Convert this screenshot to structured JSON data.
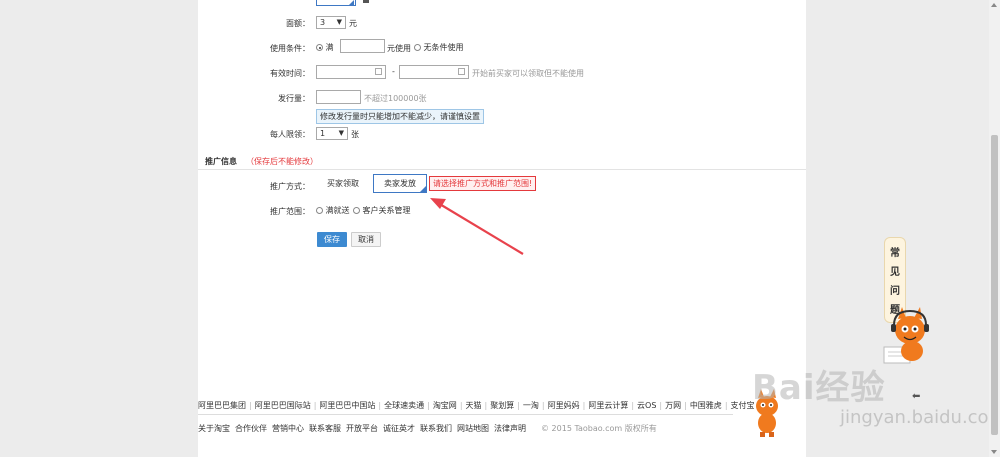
{
  "form": {
    "top_partial_label": "",
    "face_value": {
      "label": "面额：",
      "value": "3",
      "unit": "元"
    },
    "usage_condition": {
      "label": "使用条件：",
      "option_full": "满",
      "full_unit": "元使用",
      "option_none": "无条件使用"
    },
    "valid_time": {
      "label": "有效时间：",
      "dash": "-",
      "hint": "开始前买家可以领取但不能使用"
    },
    "circulation": {
      "label": "发行量：",
      "placeholder": "不超过100000张",
      "tip": "修改发行量时只能增加不能减少，请谨慎设置"
    },
    "limit_per_person": {
      "label": "每人限领：",
      "value": "1",
      "unit": "张"
    }
  },
  "promotion": {
    "section_title": "推广信息",
    "section_note": "（保存后不能修改）",
    "method_label": "推广方式：",
    "method_buyer": "买家领取",
    "method_seller": "卖家发放",
    "error_text": "请选择推广方式和推广范围!",
    "scope_label": "推广范围：",
    "scope_option1": "满就送",
    "scope_option2": "客户关系管理"
  },
  "actions": {
    "save": "保存",
    "cancel": "取消"
  },
  "footer": {
    "row1": [
      "阿里巴巴集团",
      "阿里巴巴国际站",
      "阿里巴巴中国站",
      "全球速卖通",
      "淘宝网",
      "天猫",
      "聚划算",
      "一淘",
      "阿里妈妈",
      "阿里云计算",
      "云OS",
      "万网",
      "中国雅虎",
      "支付宝"
    ],
    "row2": [
      "关于淘宝",
      "合作伙伴",
      "营销中心",
      "联系客服",
      "开放平台",
      "诚征英才",
      "联系我们",
      "网站地图",
      "法律声明"
    ],
    "copyright": "© 2015 Taobao.com 版权所有"
  },
  "faq": {
    "chars": [
      "常",
      "见",
      "问",
      "题"
    ]
  },
  "watermark": {
    "brand": "Bai经验",
    "url": "jingyan.baidu.com"
  },
  "colors": {
    "accent": "#3d8ad1",
    "error": "#e4393c",
    "annotation_arrow": "#e8424c"
  }
}
